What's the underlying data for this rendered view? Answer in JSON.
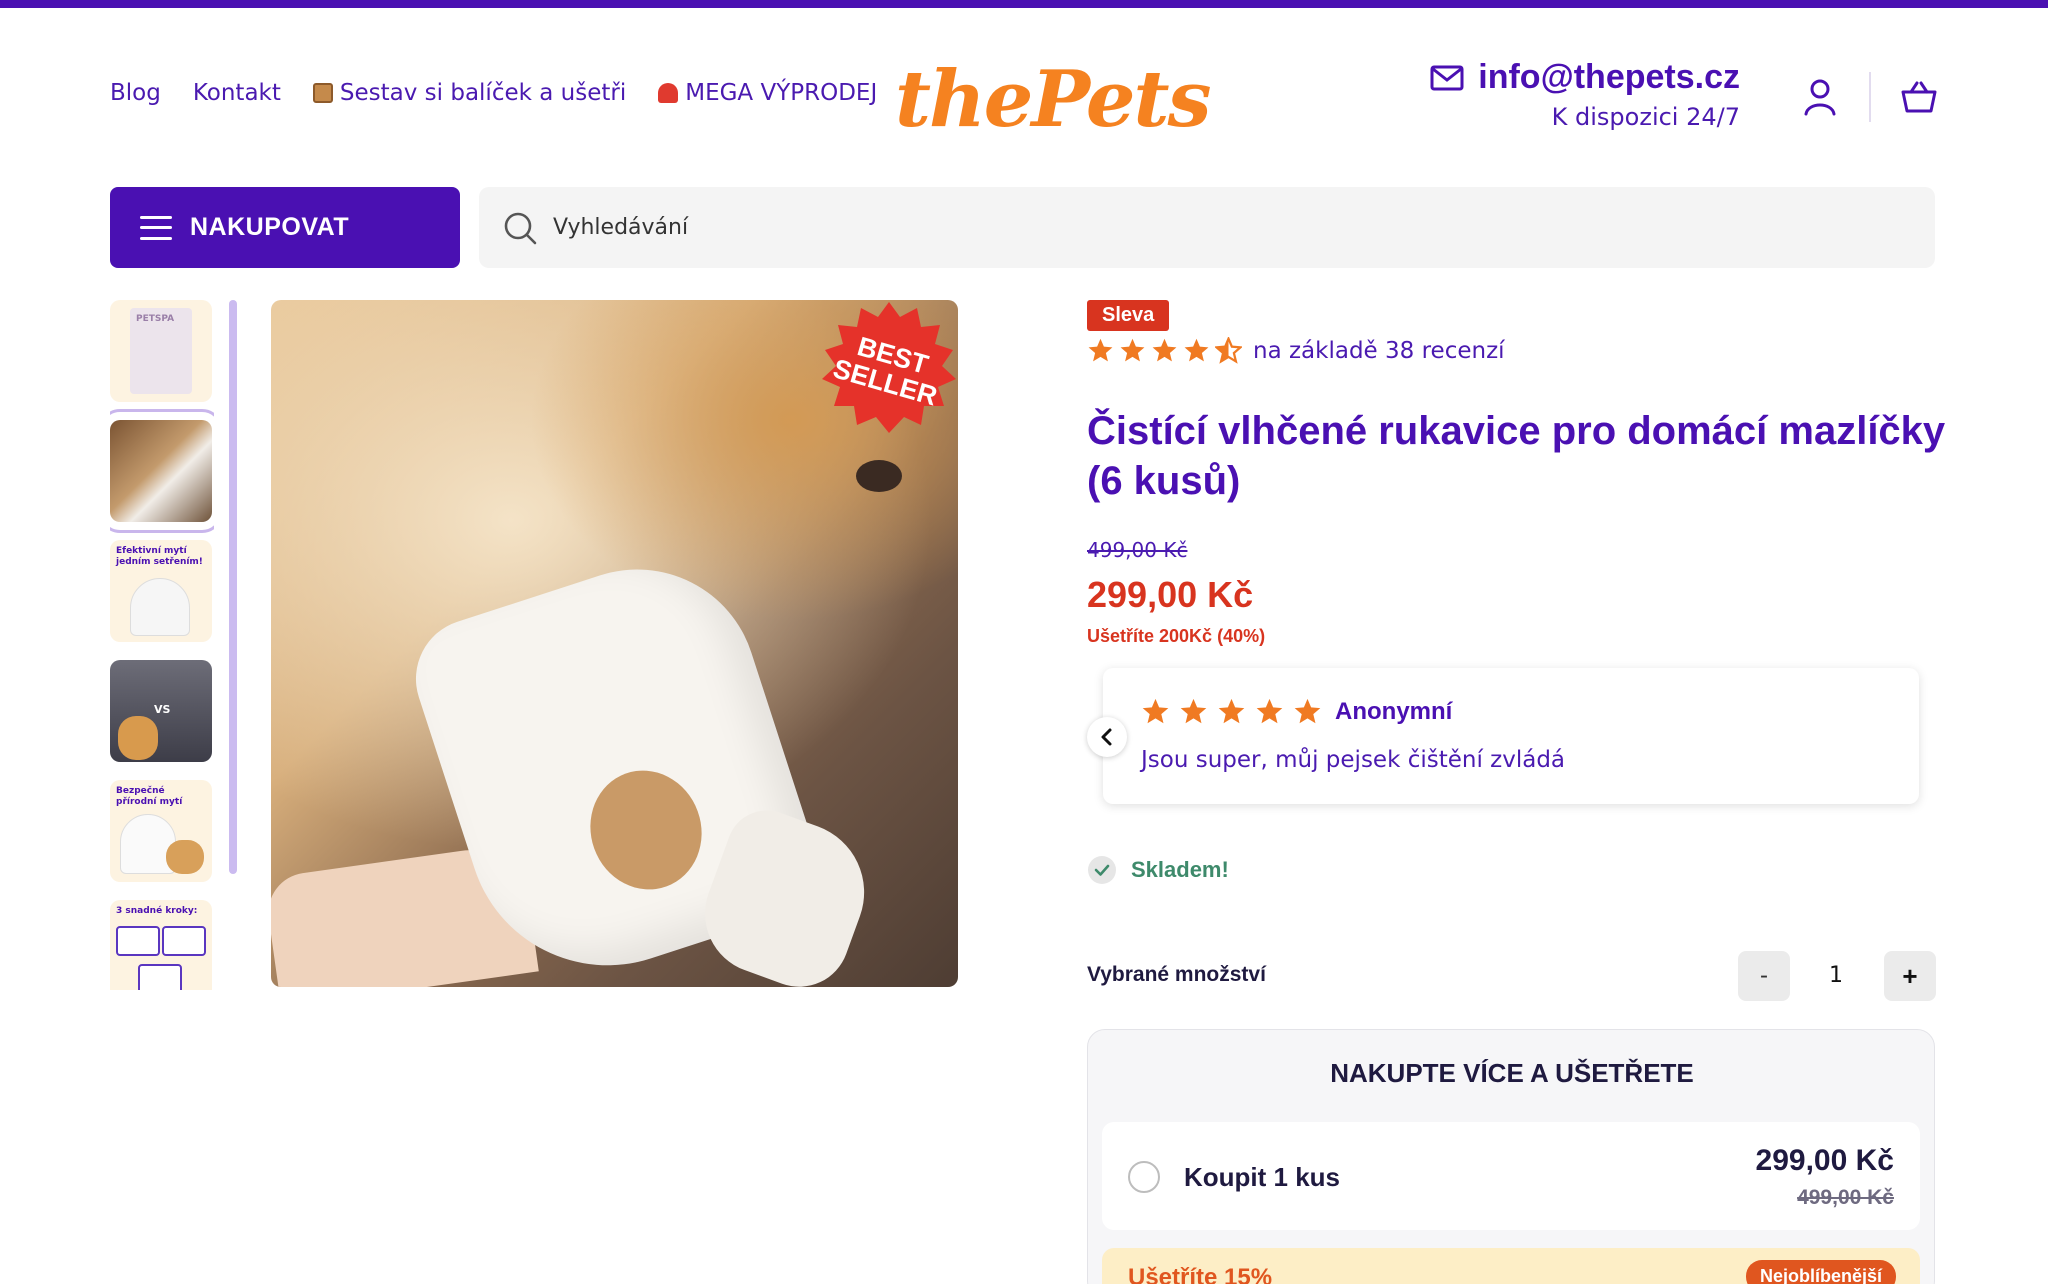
{
  "colors": {
    "brand": "#4a10b2",
    "accent": "#f58220",
    "sale": "#d8341f",
    "stock": "#3e8a6b",
    "star": "#f07a22"
  },
  "header": {
    "nav": [
      {
        "label": "Blog"
      },
      {
        "label": "Kontakt"
      },
      {
        "label": "Sestav si balíček a ušetři",
        "icon": "package-icon"
      },
      {
        "label": "MEGA VÝPRODEJ",
        "icon": "siren-icon"
      }
    ],
    "logo": "thePets",
    "email": "info@thepets.cz",
    "availability": "K dispozici 24/7"
  },
  "shop_button": "NAKUPOVAT",
  "search": {
    "placeholder": "Vyhledávání"
  },
  "gallery": {
    "badge_line1": "BEST",
    "badge_line2": "SELLER",
    "thumbnails": [
      {
        "caption": "PETSPA"
      },
      {
        "caption": ""
      },
      {
        "caption": "Efektivní mytí jedním setřením!"
      },
      {
        "caption": "VS"
      },
      {
        "caption": "Bezpečné přírodní mytí"
      },
      {
        "caption": "3 snadné kroky:"
      }
    ]
  },
  "product": {
    "sale_badge": "Sleva",
    "rating": 4.5,
    "rating_text": "na základě 38 recenzí",
    "title": "Čistící vlhčené rukavice pro domácí mazlíčky (6 kusů)",
    "price_old": "499,00 Kč",
    "price_new": "299,00 Kč",
    "price_save": "Ušetříte 200Kč (40%)"
  },
  "review": {
    "stars": 5,
    "author": "Anonymní",
    "text": "Jsou super, můj pejsek čištění zvládá"
  },
  "stock": "Skladem!",
  "quantity": {
    "label": "Vybrané množství",
    "minus": "-",
    "value": "1",
    "plus": "+"
  },
  "bundle": {
    "title": "NAKUPTE VÍCE A UŠETŘETE",
    "option1": {
      "label": "Koupit 1 kus",
      "price": "299,00 Kč",
      "old_price": "499,00 Kč"
    },
    "option2": {
      "label": "Ušetříte 15%",
      "badge": "Nejoblíbenější"
    }
  }
}
